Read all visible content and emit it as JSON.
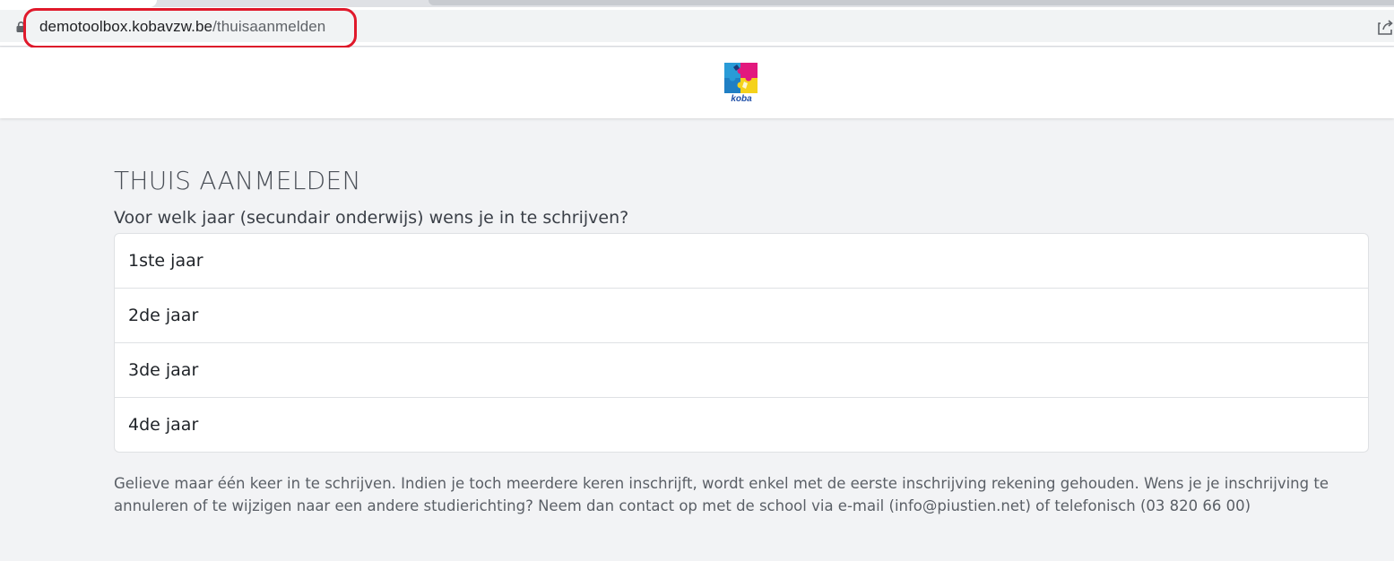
{
  "browser": {
    "url_host": "demotoolbox.kobavzw.be",
    "url_path": "/thuisaanmelden",
    "highlight_color": "#e0192b"
  },
  "header": {
    "logo_text": "koba"
  },
  "main": {
    "title": "THUIS AANMELDEN",
    "question": "Voor welk jaar (secundair onderwijs) wens je in te schrijven?",
    "options": [
      {
        "label": "1ste jaar"
      },
      {
        "label": "2de jaar"
      },
      {
        "label": "3de jaar"
      },
      {
        "label": "4de jaar"
      }
    ],
    "notice": "Gelieve maar één keer in te schrijven. Indien je toch meerdere keren inschrijft, wordt enkel met de eerste inschrijving rekening gehouden. Wens je je inschrijving te annuleren of te wijzigen naar een andere studierichting? Neem dan contact op met de school via e-mail (info@piustien.net) of telefonisch (03 820 66 00)"
  }
}
